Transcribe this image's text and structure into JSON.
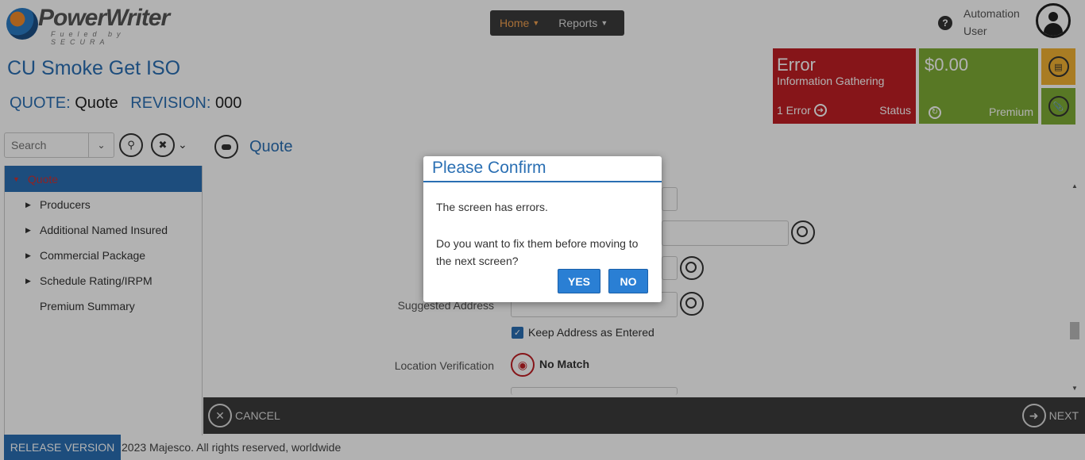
{
  "header": {
    "brand": "PowerWriter",
    "tagline": "Fueled by SECURA",
    "nav": [
      {
        "label": "Home"
      },
      {
        "label": "Reports"
      }
    ],
    "user": "Automation User"
  },
  "page": {
    "title": "CU Smoke Get ISO",
    "quote_label": "QUOTE:",
    "quote_value": "Quote",
    "revision_label": "REVISION:",
    "revision_value": "000"
  },
  "tiles": {
    "error_title": "Error",
    "error_subtitle": "Information Gathering",
    "error_count": "1 Error",
    "error_status": "Status",
    "premium_amount": "$0.00",
    "premium_label": "Premium"
  },
  "sidebar": {
    "search_placeholder": "Search",
    "root": "Quote",
    "items": [
      {
        "label": "Producers",
        "expandable": true
      },
      {
        "label": "Additional Named Insured",
        "expandable": true
      },
      {
        "label": "Commercial Package",
        "expandable": true
      },
      {
        "label": "Schedule Rating/IRPM",
        "expandable": true
      },
      {
        "label": "Premium Summary",
        "expandable": false
      }
    ]
  },
  "main": {
    "section_title": "Quote",
    "suggested_address_label": "Suggested Address",
    "keep_address_label": "Keep Address as Entered",
    "keep_address_checked": true,
    "location_verification_label": "Location Verification",
    "location_verification_value": "No Match"
  },
  "footer": {
    "cancel": "CANCEL",
    "next": "NEXT",
    "release": "RELEASE VERSION",
    "copyright": "2023 Majesco. All rights reserved, worldwide"
  },
  "modal": {
    "title": "Please Confirm",
    "message1": "The screen has errors.",
    "message2": "Do you want to fix them before moving to the next screen?",
    "yes": "YES",
    "no": "NO"
  },
  "colors": {
    "primary": "#2a6fb3",
    "error_tile": "#c01f24",
    "premium_tile": "#7fac36",
    "notes_tile": "#f2b233",
    "nav_bg": "#3b3b3b"
  }
}
